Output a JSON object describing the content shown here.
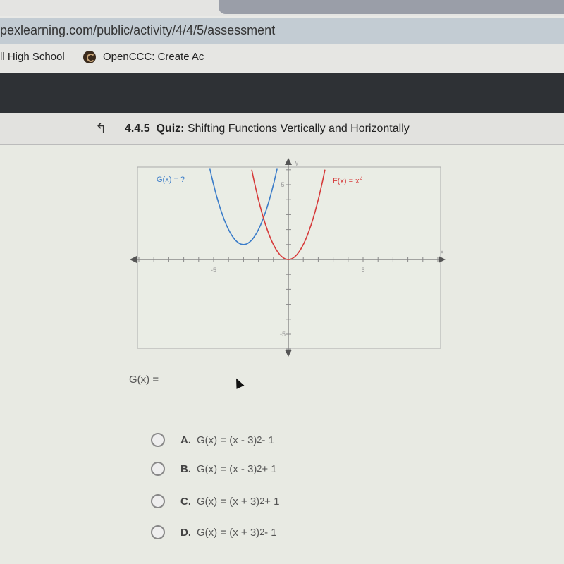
{
  "browser": {
    "url": "pexlearning.com/public/activity/4/4/5/assessment",
    "bookmarks": [
      {
        "label": "ll High School"
      },
      {
        "label": "OpenCCC: Create Ac"
      }
    ]
  },
  "quiz": {
    "number": "4.4.5",
    "type_label": "Quiz:",
    "title": "Shifting Functions Vertically and Horizontally",
    "back_icon": "up-arrow-icon"
  },
  "chart_data": {
    "type": "line",
    "xlabel": "x",
    "ylabel": "y",
    "xlim": [
      -10,
      10
    ],
    "ylim": [
      -7,
      6
    ],
    "x_tick_labels": [
      "-5",
      "5"
    ],
    "y_tick_labels": [
      "5",
      "-5"
    ],
    "series": [
      {
        "name": "G(x) = ?",
        "label": "G(x) = ?",
        "color": "#3a7cc9",
        "formula": "(x+3)^2+1",
        "vertex": [
          -3,
          1
        ]
      },
      {
        "name": "F(x) = x²",
        "label": "F(x) = x",
        "label_sup": "2",
        "color": "#d63a3a",
        "formula": "x^2",
        "vertex": [
          0,
          0
        ]
      }
    ]
  },
  "question": {
    "prompt": "G(x) =",
    "options": [
      {
        "letter": "A.",
        "text": "G(x) = (x - 3)",
        "sup": "2",
        "tail": " - 1"
      },
      {
        "letter": "B.",
        "text": "G(x) = (x - 3)",
        "sup": "2",
        "tail": " + 1"
      },
      {
        "letter": "C.",
        "text": "G(x) = (x + 3)",
        "sup": "2",
        "tail": " + 1"
      },
      {
        "letter": "D.",
        "text": "G(x) = (x + 3)",
        "sup": "2",
        "tail": " - 1"
      }
    ]
  }
}
